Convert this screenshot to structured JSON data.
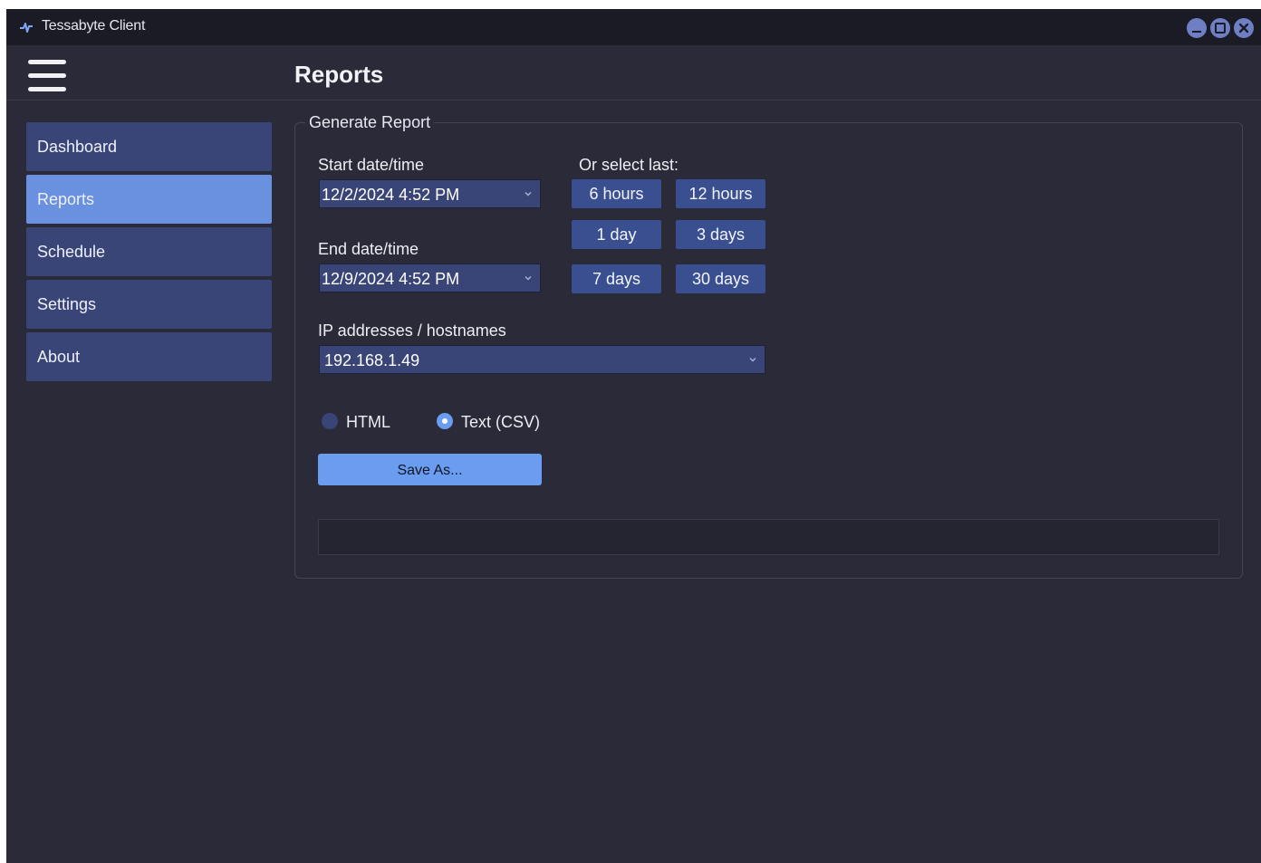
{
  "window": {
    "title": "Tessabyte Client"
  },
  "header": {
    "title": "Reports"
  },
  "sidebar": {
    "items": [
      {
        "label": "Dashboard",
        "active": false
      },
      {
        "label": "Reports",
        "active": true
      },
      {
        "label": "Schedule",
        "active": false
      },
      {
        "label": "Settings",
        "active": false
      },
      {
        "label": "About",
        "active": false
      }
    ]
  },
  "report": {
    "group_title": "Generate Report",
    "start_label": "Start date/time",
    "start_value": "12/2/2024 4:52 PM",
    "end_label": "End date/time",
    "end_value": "12/9/2024 4:52 PM",
    "quick_label": "Or select last:",
    "quick_buttons": [
      "6 hours",
      "12 hours",
      "1 day",
      "3 days",
      "7 days",
      "30 days"
    ],
    "ip_label": "IP addresses / hostnames",
    "ip_value": "192.168.1.49",
    "formats": [
      {
        "label": "HTML",
        "selected": false
      },
      {
        "label": "Text (CSV)",
        "selected": true
      }
    ],
    "save_label": "Save As...",
    "status_text": ""
  },
  "colors": {
    "window_bg": "#2a2a38",
    "titlebar_bg": "#1b1b26",
    "nav_bg": "#3a4577",
    "nav_active": "#6a90e0",
    "accent": "#6a9cf0",
    "quick_button_bg": "#3a4f90"
  },
  "icons": {
    "app": "pulse-icon",
    "menu": "hamburger-menu-icon",
    "minimize": "minimize-icon",
    "maximize": "maximize-icon",
    "close": "close-icon",
    "dropdown": "chevron-down-icon"
  }
}
